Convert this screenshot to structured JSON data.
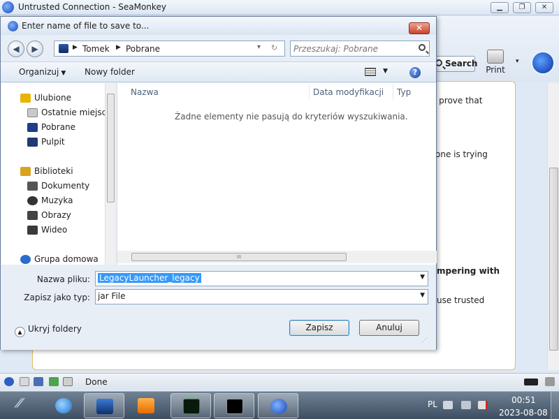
{
  "browser": {
    "title": "Untrusted Connection - SeaMonkey",
    "window_buttons": {
      "minimize": "▁",
      "maximize": "❐",
      "close": "✕"
    },
    "search_label": "Search",
    "print_label": "Print",
    "dropdown_glyph": "▾",
    "page_fragments": [
      "o prove that",
      "one is trying",
      "mpering with",
      "use trusted"
    ],
    "status_text": "Done"
  },
  "dialog": {
    "title": "Enter name of file to save to...",
    "close_glyph": "✕",
    "nav": {
      "back": "◀",
      "forward": "▶"
    },
    "breadcrumb": {
      "arrow": "▶",
      "items": [
        "Tomek",
        "Pobrane"
      ]
    },
    "address_dropdown": "▾",
    "address_refresh": "↻",
    "search_placeholder": "Przeszukaj: Pobrane",
    "commands": {
      "organize": "Organizuj",
      "organize_caret": "▼",
      "new_folder": "Nowy folder",
      "views_caret": "▼",
      "help": "?"
    },
    "nav_pane": {
      "favorites_header": "Ulubione",
      "favorites": [
        "Ostatnie miejsca",
        "Pobrane",
        "Pulpit"
      ],
      "libraries_header": "Biblioteki",
      "libraries": [
        "Dokumenty",
        "Muzyka",
        "Obrazy",
        "Wideo"
      ],
      "homegroup": "Grupa domowa"
    },
    "file_list": {
      "columns": [
        "Nazwa",
        "Data modyfikacji",
        "Typ"
      ],
      "empty_message": "Żadne elementy nie pasują do kryteriów wyszukiwania."
    },
    "fields": {
      "filename_label": "Nazwa pliku:",
      "filename_value": "LegacyLauncher_legacy",
      "filetype_label": "Zapisz jako typ:",
      "filetype_value": "jar File",
      "dropdown": "▼"
    },
    "hide_folders": "Ukryj foldery",
    "hide_glyph": "▲",
    "save_label": "Zapisz",
    "cancel_label": "Anuluj"
  },
  "taskbar": {
    "language": "PL",
    "time": "00:51",
    "date": "2023-08-08"
  },
  "colors": {
    "accent": "#3399ff",
    "content_border": "#e8b960",
    "taskbar": "#4a5c70"
  }
}
